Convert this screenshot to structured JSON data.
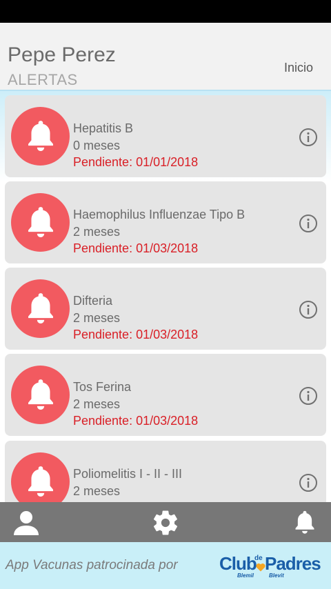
{
  "header": {
    "user_name": "Pepe Perez",
    "page_title": "ALERTAS",
    "inicio_label": "Inicio"
  },
  "alerts": [
    {
      "name": "Hepatitis B",
      "age": "0 meses",
      "pending": "Pendiente: 01/01/2018"
    },
    {
      "name": "Haemophilus Influenzae Tipo B",
      "age": "2 meses",
      "pending": "Pendiente: 01/03/2018"
    },
    {
      "name": "Difteria",
      "age": "2 meses",
      "pending": "Pendiente: 01/03/2018"
    },
    {
      "name": "Tos Ferina",
      "age": "2 meses",
      "pending": "Pendiente: 01/03/2018"
    },
    {
      "name": "Poliomelitis I - II - III",
      "age": "2 meses",
      "pending": ""
    }
  ],
  "icons": {
    "alert": "bell-icon",
    "info": "info-icon",
    "nav_profile": "user-icon",
    "nav_settings": "gear-icon",
    "nav_alerts": "bell-icon"
  },
  "sponsor": {
    "text": "App Vacunas patrocinada por",
    "logo_club": "Club",
    "logo_de": "de",
    "logo_padres": "Padres",
    "logo_sub1": "Blemil",
    "logo_sub2": "Blevit"
  },
  "colors": {
    "alert_red": "#f25a60",
    "pending_red": "#d91f26",
    "nav_bg": "#777777",
    "sponsor_bg": "#c9eff8",
    "brand_blue": "#1a5ea8",
    "heart_orange": "#f5a623"
  }
}
